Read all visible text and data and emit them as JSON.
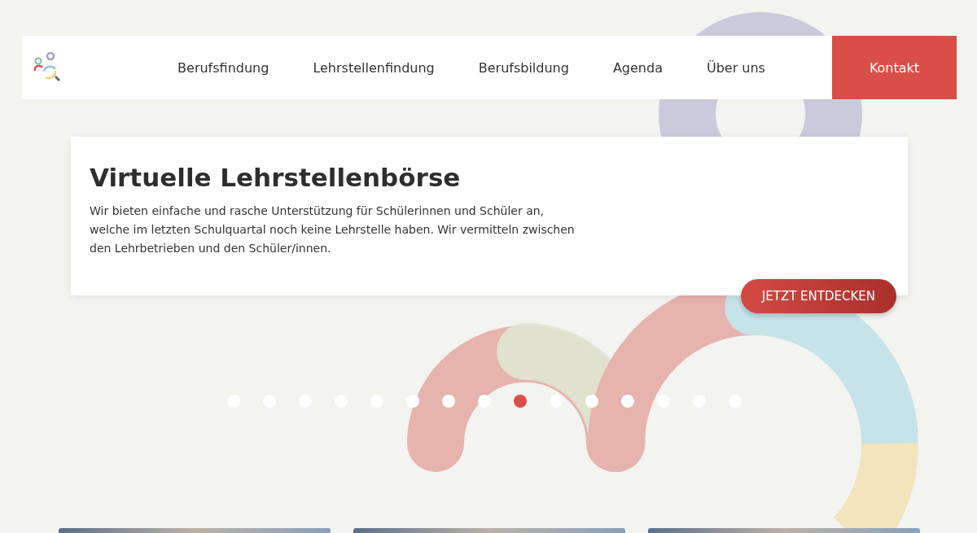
{
  "header": {
    "nav": [
      {
        "label": "Berufsfindung"
      },
      {
        "label": "Lehrstellenfindung"
      },
      {
        "label": "Berufsbildung"
      },
      {
        "label": "Agenda"
      },
      {
        "label": "Über uns"
      }
    ],
    "contact": "Kontakt"
  },
  "hero": {
    "title": "Virtuelle Lehrstellenbörse",
    "text": "Wir bieten einfache und rasche Unterstützung für Schülerinnen und Schüler an, welche im letzten Schulquartal noch keine Lehrstelle haben. Wir vermitteln zwischen den Lehrbetrieben und den Schüler/innen.",
    "button": "JETZT ENTDECKEN"
  },
  "slides": [
    {
      "selected": false
    },
    {
      "selected": false
    },
    {
      "selected": false
    },
    {
      "selected": false
    },
    {
      "selected": false
    },
    {
      "selected": false
    },
    {
      "selected": false
    },
    {
      "selected": false
    },
    {
      "selected": true
    },
    {
      "selected": false
    },
    {
      "selected": false
    },
    {
      "selected": false
    },
    {
      "selected": false
    },
    {
      "selected": false
    },
    {
      "selected": false
    }
  ],
  "cards": [
    {
      "kind": "photo"
    },
    {
      "kind": "photo"
    },
    {
      "kind": "photo"
    }
  ]
}
